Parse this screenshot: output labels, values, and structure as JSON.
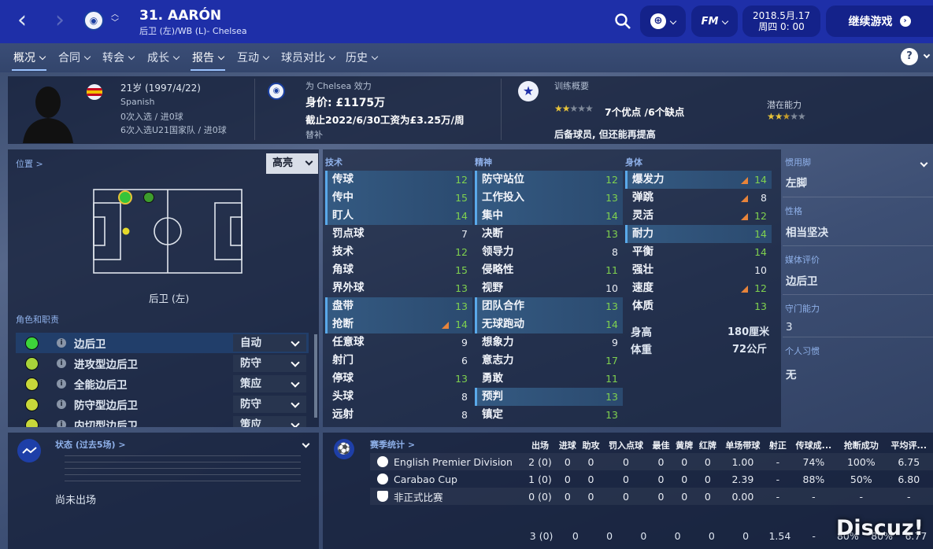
{
  "header": {
    "player_title": "31. AARÓN",
    "player_subtitle": "后卫 (左)/WB (L)- Chelsea",
    "date": "2018.5月.17",
    "day_time": "周四 0: 00",
    "continue_label": "继续游戏",
    "fm_label": "FM"
  },
  "tabs": [
    "概况",
    "合同",
    "转会",
    "成长",
    "报告",
    "互动",
    "球员对比",
    "历史"
  ],
  "profile": {
    "age_line": "21岁 (1997/4/22)",
    "nationality": "Spanish",
    "caps_line": "0次入选 / 进0球",
    "u21_line": "6次入选U21国家队 / 进0球",
    "club_label": "为 Chelsea 效力",
    "value": "身价: £1175万",
    "contract": "截止2022/6/30工资为£3.25万/周",
    "squad_status": "替补",
    "training_label": "训练概要",
    "strengths": "7个优点 /6个缺点",
    "potential_label": "潜在能力",
    "role_note": "后备球员, 但还能再提高",
    "current_stars": 2,
    "potential_stars": 2.5
  },
  "position": {
    "label": "位置 >",
    "filter": "高亮",
    "position_name": "后卫 (左)"
  },
  "roles": {
    "label": "角色和职责",
    "items": [
      {
        "name": "边后卫",
        "duty": "自动",
        "color": "#3dd43a",
        "selected": true
      },
      {
        "name": "进攻型边后卫",
        "duty": "防守",
        "color": "#a8d43a",
        "selected": false
      },
      {
        "name": "全能边后卫",
        "duty": "策应",
        "color": "#c8d83a",
        "selected": false
      },
      {
        "name": "防守型边后卫",
        "duty": "防守",
        "color": "#c8d83a",
        "selected": false
      },
      {
        "name": "内切型边后卫",
        "duty": "策应",
        "color": "#c8d83a",
        "selected": false
      }
    ]
  },
  "attributes": {
    "technical": {
      "label": "技术",
      "items": [
        {
          "name": "传球",
          "value": "12",
          "hl": true,
          "green": true
        },
        {
          "name": "传中",
          "value": "15",
          "hl": true,
          "green": true
        },
        {
          "name": "盯人",
          "value": "14",
          "hl": true,
          "green": true
        },
        {
          "name": "罚点球",
          "value": "7"
        },
        {
          "name": "技术",
          "value": "12",
          "green": true
        },
        {
          "name": "角球",
          "value": "15",
          "green": true
        },
        {
          "name": "界外球",
          "value": "13",
          "green": true
        },
        {
          "name": "盘带",
          "value": "13",
          "hl": true,
          "green": true
        },
        {
          "name": "抢断",
          "value": "14",
          "hl": true,
          "green": true,
          "arrow": true
        },
        {
          "name": "任意球",
          "value": "9"
        },
        {
          "name": "射门",
          "value": "6"
        },
        {
          "name": "停球",
          "value": "13",
          "green": true
        },
        {
          "name": "头球",
          "value": "8"
        },
        {
          "name": "远射",
          "value": "8"
        }
      ]
    },
    "mental": {
      "label": "精神",
      "items": [
        {
          "name": "防守站位",
          "value": "12",
          "hl": true,
          "green": true
        },
        {
          "name": "工作投入",
          "value": "13",
          "hl": true,
          "green": true
        },
        {
          "name": "集中",
          "value": "14",
          "hl": true,
          "green": true
        },
        {
          "name": "决断",
          "value": "13",
          "green": true
        },
        {
          "name": "领导力",
          "value": "8"
        },
        {
          "name": "侵略性",
          "value": "11",
          "green": true
        },
        {
          "name": "视野",
          "value": "10"
        },
        {
          "name": "团队合作",
          "value": "13",
          "hl": true,
          "green": true
        },
        {
          "name": "无球跑动",
          "value": "14",
          "hl": true,
          "green": true
        },
        {
          "name": "想象力",
          "value": "9"
        },
        {
          "name": "意志力",
          "value": "17",
          "green": true
        },
        {
          "name": "勇敢",
          "value": "11",
          "green": true
        },
        {
          "name": "预判",
          "value": "13",
          "hl": true,
          "green": true
        },
        {
          "name": "镇定",
          "value": "13",
          "green": true
        }
      ]
    },
    "physical": {
      "label": "身体",
      "items": [
        {
          "name": "爆发力",
          "value": "14",
          "hl": true,
          "green": true,
          "arrow": true
        },
        {
          "name": "弹跳",
          "value": "8",
          "arrow": true
        },
        {
          "name": "灵活",
          "value": "12",
          "green": true,
          "arrow": true
        },
        {
          "name": "耐力",
          "value": "14",
          "hl": true,
          "green": true
        },
        {
          "name": "平衡",
          "value": "14",
          "green": true
        },
        {
          "name": "强壮",
          "value": "10"
        },
        {
          "name": "速度",
          "value": "12",
          "green": true,
          "arrow": true
        },
        {
          "name": "体质",
          "value": "13",
          "green": true
        }
      ]
    },
    "height_label": "身高",
    "height": "180厘米",
    "weight_label": "体重",
    "weight": "72公斤"
  },
  "info": [
    {
      "label": "惯用脚",
      "value": "左脚"
    },
    {
      "label": "性格",
      "value": "相当坚决"
    },
    {
      "label": "媒体评价",
      "value": "边后卫"
    },
    {
      "label": "守门能力",
      "value": "3"
    },
    {
      "label": "个人习惯",
      "value": "无"
    }
  ],
  "form": {
    "label": "状态 (过去5场) >",
    "empty": "尚未出场"
  },
  "season": {
    "label": "赛季统计 >",
    "columns": [
      "出场",
      "进球",
      "助攻",
      "罚入点球",
      "最佳",
      "黄牌",
      "红牌",
      "单场带球",
      "射正",
      "传球成...",
      "抢断成功",
      "平均评..."
    ],
    "rows": [
      {
        "comp": "English Premier Division",
        "vals": [
          "2 (0)",
          "0",
          "0",
          "0",
          "0",
          "0",
          "0",
          "1.00",
          "-",
          "74%",
          "100%",
          "6.75"
        ]
      },
      {
        "comp": "Carabao Cup",
        "vals": [
          "1 (0)",
          "0",
          "0",
          "0",
          "0",
          "0",
          "0",
          "2.39",
          "-",
          "88%",
          "50%",
          "6.80"
        ]
      },
      {
        "comp": "非正式比赛",
        "vals": [
          "0 (0)",
          "0",
          "0",
          "0",
          "0",
          "0",
          "0",
          "0.00",
          "-",
          "-",
          "-",
          "-"
        ]
      }
    ],
    "total": [
      "3 (0)",
      "0",
      "0",
      "0",
      "0",
      "0",
      "0",
      "1.54",
      "-",
      "80%",
      "80%",
      "6.77"
    ]
  },
  "watermark": "Discuz!"
}
